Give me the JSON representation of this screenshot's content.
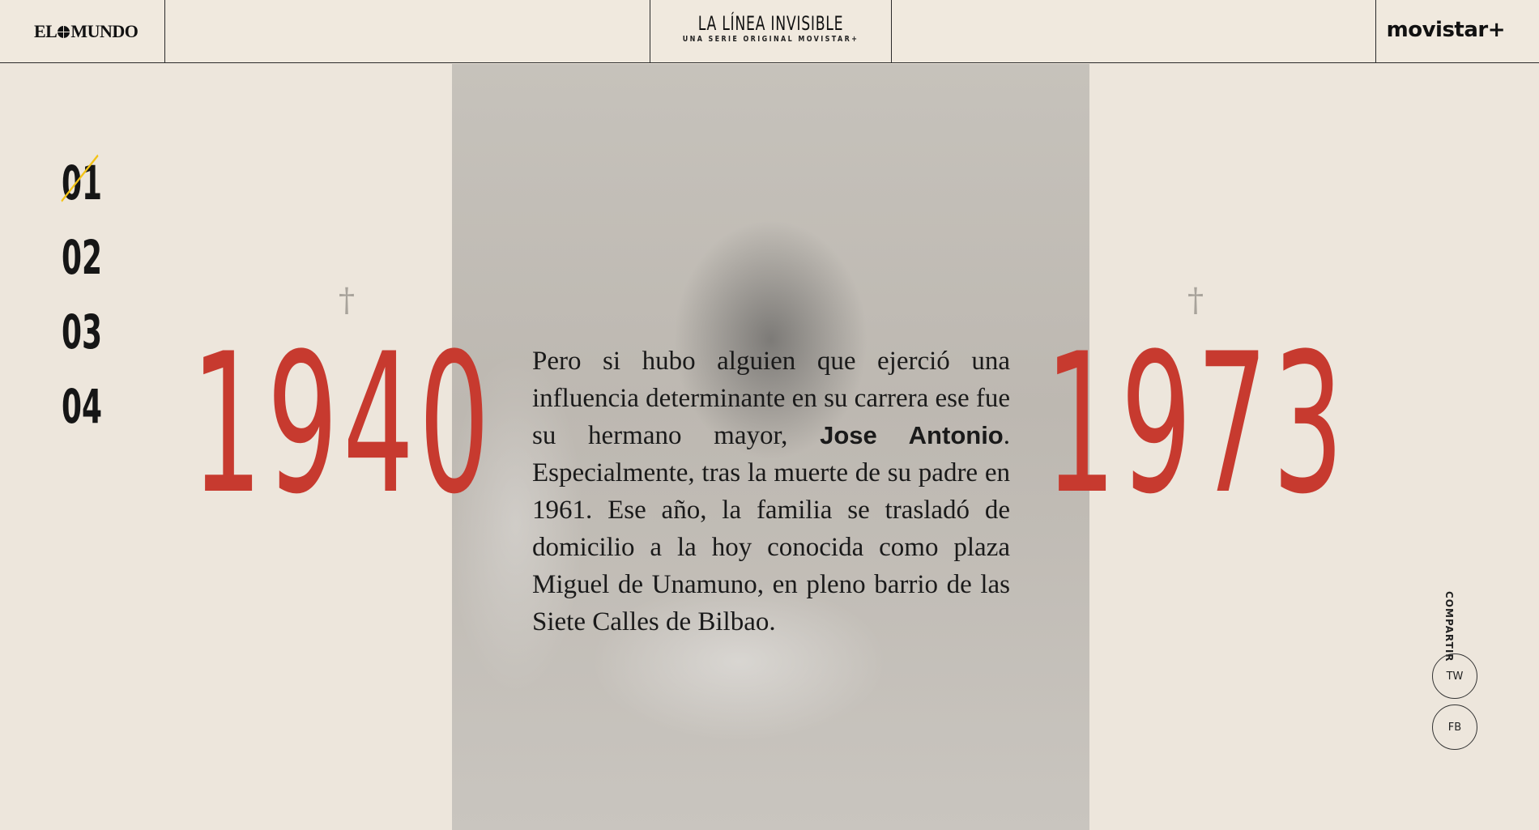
{
  "header": {
    "brand_left": {
      "part1": "EL",
      "part2": "MUNDO"
    },
    "series_title": "LA LÍNEA INVISIBLE",
    "series_subtitle": "UNA SERIE ORIGINAL MOVISTAR+",
    "brand_right": "movistar+"
  },
  "chapters": [
    "01",
    "02",
    "03",
    "04"
  ],
  "active_chapter": "01",
  "birth_year": "1940",
  "death_year": "1973",
  "cross_symbol": "†",
  "story": {
    "before": "Pero si hubo alguien que ejerció una influencia determinante en su carrera ese fue su hermano mayor, ",
    "highlight": "Jose Antonio",
    "after": ". Especialmente, tras la muerte de su padre en 1961. Ese año, la familia se trasladó de domicilio a la hoy conocida como plaza Miguel de Unamuno, en pleno barrio de las Siete Calles de Bilbao."
  },
  "share": {
    "label": "COMPARTIR",
    "twitter": "TW",
    "facebook": "FB"
  },
  "colors": {
    "background": "#ede6dc",
    "year_red": "#c73a2f",
    "accent_yellow": "#f3c316"
  }
}
